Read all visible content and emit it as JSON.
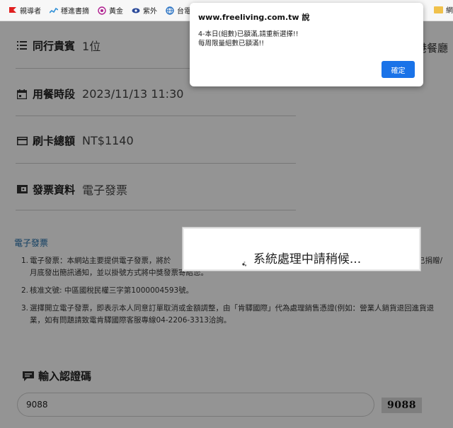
{
  "bookmarks": [
    {
      "label": "親導者",
      "icon": "flag-icon",
      "color": "#e02020"
    },
    {
      "label": "穩進書摘",
      "icon": "chart-icon",
      "color": "#2f8fd6"
    },
    {
      "label": "黃金",
      "icon": "circle-logo-icon",
      "color": "#b02090"
    },
    {
      "label": "紫外",
      "icon": "eye-icon",
      "color": "#2b4a9a"
    },
    {
      "label": "台電",
      "icon": "globe-icon",
      "color": "#2a73c4"
    }
  ],
  "bookmarks_right": {
    "label": "網"
  },
  "details": {
    "companions": {
      "label": "同行貴賓",
      "value": "1位"
    },
    "time": {
      "label": "用餐時段",
      "value": "2023/11/13 11:30"
    },
    "card": {
      "label": "刷卡總額",
      "value": "NT$1140"
    },
    "invoice": {
      "label": "發票資料",
      "value": "電子發票"
    }
  },
  "right_cut_text": "港餐廳",
  "einvoice": {
    "title": "電子發票",
    "notes": [
      {
        "num": "1.",
        "line1": "電子發票：本網站主要提供電子發票，將於",
        "line1_end": "已捐贈/",
        "line2": "月底發出簡訊通知，並以掛號方式將中獎發票寄給您。"
      },
      {
        "num": "2.",
        "line1": "核准文號: 中區國稅民權三字第1000004593號。"
      },
      {
        "num": "3.",
        "line1": "選擇開立電子發票，即表示本人同意訂單取消或金額調整，由「肯驛國際」代為處理銷售憑證(例如：營業人銷貨退回進貨退",
        "line2": "業，如有問題請致電肯驛國際客服專線04-2206-3313洽詢。"
      }
    ]
  },
  "captcha": {
    "title": "輸入認證碼",
    "input_value": "9088",
    "image_text": "9088"
  },
  "processing": {
    "text": "系統處理中請稍候..."
  },
  "alert": {
    "title": "www.freeliving.com.tw 說",
    "message_line1": "4-本日(組數)已額滿,請重新選擇!!",
    "message_line2": "每周限量組數已額滿!!",
    "ok_label": "確定",
    "button_color": "#1a73e8"
  }
}
